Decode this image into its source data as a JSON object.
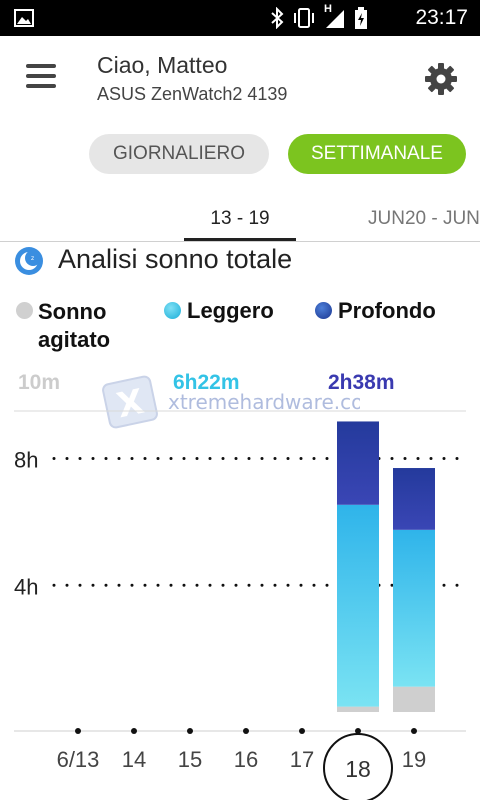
{
  "status_bar": {
    "time": "23:17",
    "network": "H"
  },
  "header": {
    "greeting": "Ciao, Matteo",
    "device": "ASUS ZenWatch2 4139"
  },
  "view_toggle": {
    "daily_label": "GIORNALIERO",
    "weekly_label": "SETTIMANALE",
    "selected": "weekly"
  },
  "week_tabs": {
    "current": "13 - 19",
    "next": "JUN20 - JUN"
  },
  "section": {
    "title": "Analisi sonno totale"
  },
  "legend": [
    {
      "label_line1": "Sonno",
      "label_line2": "agitato",
      "color": "#cccccc"
    },
    {
      "label_line1": "Leggero",
      "label_line2": "",
      "color": "#33c3e6"
    },
    {
      "label_line1": "Profondo",
      "label_line2": "",
      "color": "#2546b2"
    }
  ],
  "totals": {
    "restless": "10m",
    "light": "6h22m",
    "deep": "2h38m"
  },
  "watermark": {
    "text": "xtremehardware.com"
  },
  "colors": {
    "accent_green": "#7cc41f",
    "light_value": "#33c3e6",
    "deep_value": "#3a3ab0",
    "restless_value": "#cccccc"
  },
  "chart_data": {
    "type": "bar",
    "stacked": true,
    "categories": [
      "6/13",
      "14",
      "15",
      "16",
      "17",
      "18",
      "19"
    ],
    "selected_category": "18",
    "unit": "hours",
    "ylim": [
      0,
      9.5
    ],
    "y_ticks": [
      {
        "value": 4,
        "label": "4h"
      },
      {
        "value": 8,
        "label": "8h"
      }
    ],
    "grid": "dotted at ticks",
    "series": [
      {
        "name": "Sonno agitato",
        "color": "#cfcfcf",
        "values": [
          0,
          0,
          0,
          0,
          0,
          0.17,
          0.8
        ]
      },
      {
        "name": "Leggero",
        "color": "#39c0e8",
        "values": [
          0,
          0,
          0,
          0,
          0,
          6.37,
          4.95
        ]
      },
      {
        "name": "Profondo",
        "color": "#2f3fa8",
        "values": [
          0,
          0,
          0,
          0,
          0,
          2.63,
          1.95
        ]
      }
    ]
  }
}
